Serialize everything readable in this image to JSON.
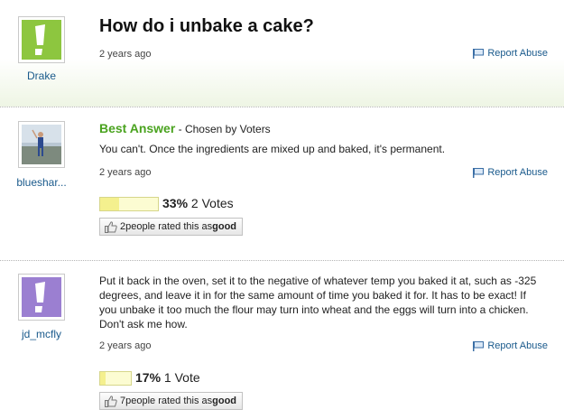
{
  "question": {
    "title": "How do i unbake a cake?",
    "asker": "Drake",
    "age": "2 years ago",
    "report_label": "Report Abuse"
  },
  "best_answer": {
    "label": "Best Answer",
    "chosen_by": " - Chosen by Voters",
    "author": "bluesha r...",
    "author_display": "blueshar...",
    "text": "You can't. Once the ingredients are mixed up and baked, it's permanent.",
    "age": "2 years ago",
    "report_label": "Report Abuse",
    "vote_fraction": 0.33,
    "vote_percent": "33%",
    "vote_count": "2 Votes",
    "rating_count": "2",
    "rating_text": " people rated this as ",
    "rating_word": "good"
  },
  "answer2": {
    "author": "jd_mcfly",
    "text": "Put it back in the oven, set it to the negative of whatever temp you baked it at, such as -325 degrees, and leave it in for the same amount of time you baked it for. It has to be exact! If you unbake it too much the flour may turn into wheat and the eggs will turn into a chicken. Don't ask me how.",
    "age": "2 years ago",
    "report_label": "Report Abuse",
    "vote_fraction": 0.17,
    "vote_percent": "17%",
    "vote_count": "1 Vote",
    "rating_count": "7",
    "rating_text": " people rated this as ",
    "rating_word": "good"
  },
  "colors": {
    "default_avatar_green": "#8dc63f",
    "default_avatar_purple": "#9b7fd1",
    "link_blue": "#1a5a8c",
    "best_answer_green": "#4aa31f"
  }
}
